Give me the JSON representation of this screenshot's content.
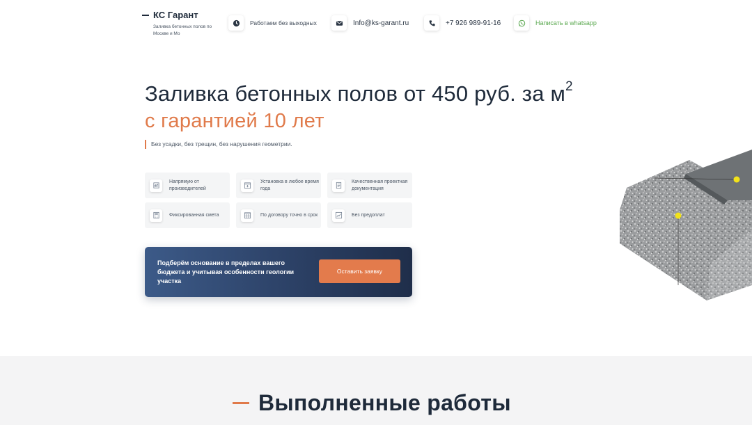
{
  "header": {
    "logo_title": "КС Гарант",
    "logo_subtitle": "Заливка бетонных полов по Москве и Мо",
    "hours": "Работаем без выходных",
    "email": "Info@ks-garant.ru",
    "phone": "+7 926 989-91-16",
    "whatsapp": "Написать в whatsapp"
  },
  "hero": {
    "title_main": "Заливка бетонных полов от 450 руб. за м",
    "title_sup": "2",
    "subtitle": "с гарантией 10 лет",
    "note": "Без усадки, без трещин, без нарушения геометрии."
  },
  "features": [
    {
      "label": "Напрямую от производителей",
      "icon": "factory-icon"
    },
    {
      "label": "Установка в любое время года",
      "icon": "calendar-plus-icon"
    },
    {
      "label": "Качественная проектная документация",
      "icon": "document-icon"
    },
    {
      "label": "Фиксированная смета",
      "icon": "calculator-icon"
    },
    {
      "label": "По договору точно в срок",
      "icon": "calendar-grid-icon"
    },
    {
      "label": "Без предоплат",
      "icon": "chart-icon"
    }
  ],
  "cta": {
    "text": "Подберём основание в пределах вашего бюджета и учитывая особенности геологии участка",
    "button": "Оставить заявку"
  },
  "works": {
    "title": "Выполненные работы"
  },
  "colors": {
    "accent": "#e07a4a",
    "dark": "#1e2a3a",
    "whatsapp": "#5aa84f",
    "cta_start": "#3c5a88",
    "cta_end": "#1f2e4a",
    "marker": "#f2e21a"
  }
}
